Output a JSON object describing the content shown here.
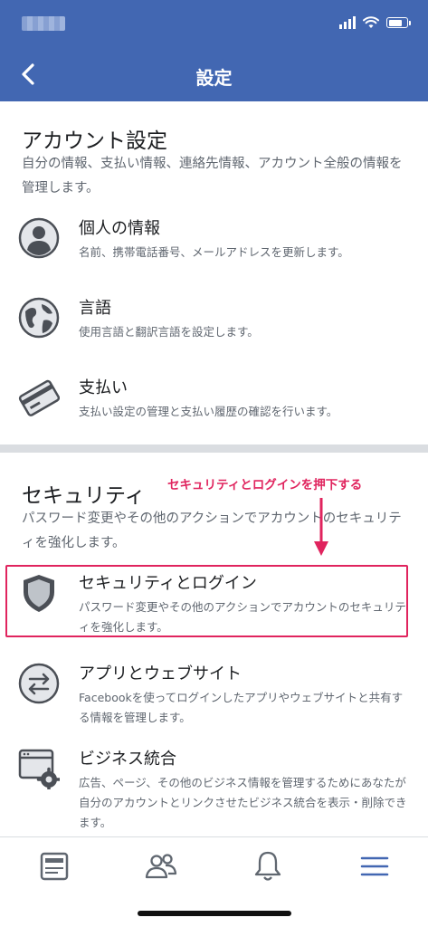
{
  "header": {
    "title": "設定"
  },
  "account": {
    "title": "アカウント設定",
    "description": "自分の情報、支払い情報、連絡先情報、アカウント全般の情報を管理します。",
    "items": [
      {
        "label": "個人の情報",
        "desc": "名前、携帯電話番号、メールアドレスを更新します。",
        "icon": "person-icon"
      },
      {
        "label": "言語",
        "desc": "使用言語と翻訳言語を設定します。",
        "icon": "globe-icon"
      },
      {
        "label": "支払い",
        "desc": "支払い設定の管理と支払い履歴の確認を行います。",
        "icon": "credit-card-icon"
      }
    ]
  },
  "security": {
    "title": "セキュリティ",
    "description": "パスワード変更やその他のアクションでアカウントのセキュリティを強化します。",
    "items": [
      {
        "label": "セキュリティとログイン",
        "desc": "パスワード変更やその他のアクションでアカウントのセキュリティを強化します。",
        "icon": "shield-icon"
      },
      {
        "label": "アプリとウェブサイト",
        "desc": "Facebookを使ってログインしたアプリやウェブサイトと共有する情報を管理します。",
        "icon": "swap-arrows-icon"
      },
      {
        "label": "ビジネス統合",
        "desc": "広告、ページ、その他のビジネス情報を管理するためにあなたが自分のアカウントとリンクさせたビジネス統合を表示・削除できます。",
        "icon": "browser-gear-icon"
      }
    ]
  },
  "annotation": {
    "text": "セキュリティとログインを押下する",
    "color": "#e0245e"
  },
  "tabs": [
    "news-feed-icon",
    "friends-icon",
    "bell-icon",
    "menu-icon"
  ],
  "colors": {
    "brand": "#4267b2",
    "active_tab": "#4267b2",
    "inactive_tab": "#606770"
  }
}
